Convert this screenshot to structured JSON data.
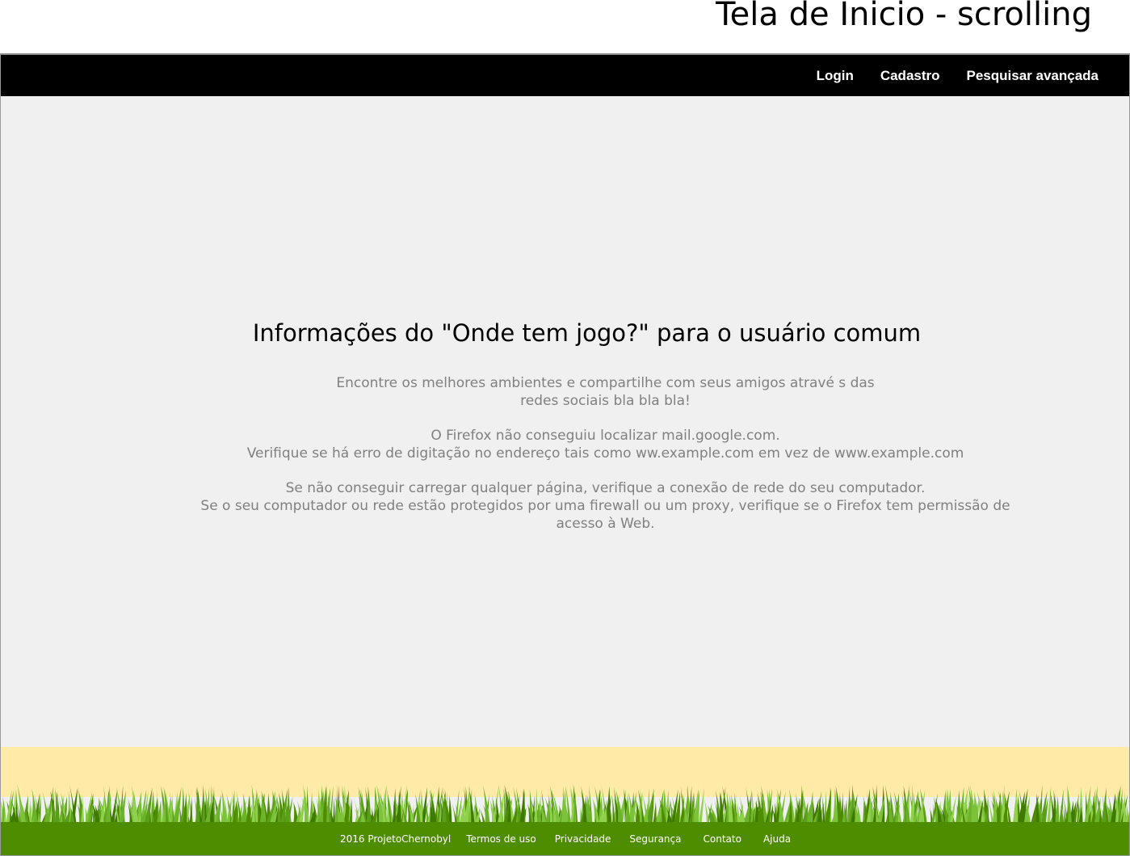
{
  "caption": "Tela de Inicio - scrolling",
  "navbar": {
    "links": [
      "Login",
      "Cadastro",
      "Pesquisar avançada"
    ]
  },
  "main": {
    "heading": "Informações do \"Onde tem jogo?\" para o usuário comum",
    "intro": [
      "Encontre os melhores ambientes e compartilhe com seus amigos atravé s das",
      "redes sociais bla bla bla!"
    ],
    "firefox_error": [
      "O Firefox não conseguiu localizar mail.google.com.",
      "Verifique se há erro de digitação no endereço tais como  ww.example.com em vez de  www.example.com"
    ],
    "network_hint": [
      "Se não conseguir carregar qualquer página, verifique a conexão de rede  do seu computador.",
      "Se o seu computador ou rede estão protegidos por uma firewall ou um proxy, verifique se o Firefox tem permissão de",
      "acesso à Web."
    ]
  },
  "footer": {
    "copyright": "2016 ProjetoChernobyl",
    "links": [
      "Termos de uso",
      "Privacidade",
      "Segurança",
      "Contato",
      "Ajuda"
    ]
  },
  "colors": {
    "navbar": "#000000",
    "content_bg": "#f0f0f0",
    "body_text": "#808080",
    "sky": "#ffeaa8",
    "grass": "#4f8d00"
  }
}
